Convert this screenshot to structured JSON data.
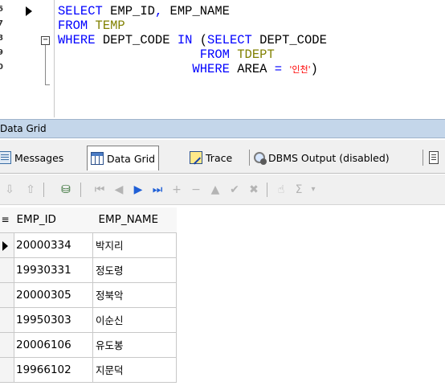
{
  "editor": {
    "line_numbers": [
      "6",
      "7",
      "8",
      "9",
      "0"
    ],
    "lines": [
      [
        {
          "t": "SELECT ",
          "c": "kw"
        },
        {
          "t": "EMP_ID",
          "c": "id"
        },
        {
          "t": ", ",
          "c": "kw"
        },
        {
          "t": "EMP_NAME",
          "c": "id"
        }
      ],
      [
        {
          "t": "FROM ",
          "c": "kw"
        },
        {
          "t": "TEMP",
          "c": "tbl"
        }
      ],
      [
        {
          "t": "WHERE ",
          "c": "kw"
        },
        {
          "t": "DEPT_CODE ",
          "c": "id"
        },
        {
          "t": "IN ",
          "c": "kw"
        },
        {
          "t": "(",
          "c": "id"
        },
        {
          "t": "SELECT ",
          "c": "kw"
        },
        {
          "t": "DEPT_CODE",
          "c": "id"
        }
      ],
      [
        {
          "t": "                   FROM ",
          "c": "kw"
        },
        {
          "t": "TDEPT",
          "c": "tbl"
        }
      ],
      [
        {
          "t": "                  WHERE ",
          "c": "kw"
        },
        {
          "t": "AREA ",
          "c": "id"
        },
        {
          "t": "= ",
          "c": "kw"
        },
        {
          "t": "'인천'",
          "c": "str"
        },
        {
          "t": ")",
          "c": "id"
        }
      ]
    ]
  },
  "panel_title": "Data Grid",
  "tabs": {
    "messages": "Messages",
    "data_grid": "Data Grid",
    "trace": "Trace",
    "dbms_output": "DBMS Output (disabled)"
  },
  "toolbar": {
    "first": "⏮",
    "prev": "◀",
    "next": "▶",
    "last": "⏭",
    "insert": "+",
    "delete": "−",
    "edit": "▲",
    "post": "✔",
    "cancel": "✖",
    "refresh": "☝",
    "sum": "Σ",
    "dropdown": "▾"
  },
  "grid": {
    "columns": [
      "EMP_ID",
      "EMP_NAME"
    ],
    "rows": [
      [
        "20000334",
        "박지리"
      ],
      [
        "19930331",
        "정도령"
      ],
      [
        "20000305",
        "정북악"
      ],
      [
        "19950303",
        "이순신"
      ],
      [
        "20006106",
        "유도봉"
      ],
      [
        "19966102",
        "지문덕"
      ]
    ]
  },
  "colors": {
    "keyword": "#0000ff",
    "table": "#808000",
    "string": "#ff0000",
    "titlebar": "#c4d6ea"
  }
}
